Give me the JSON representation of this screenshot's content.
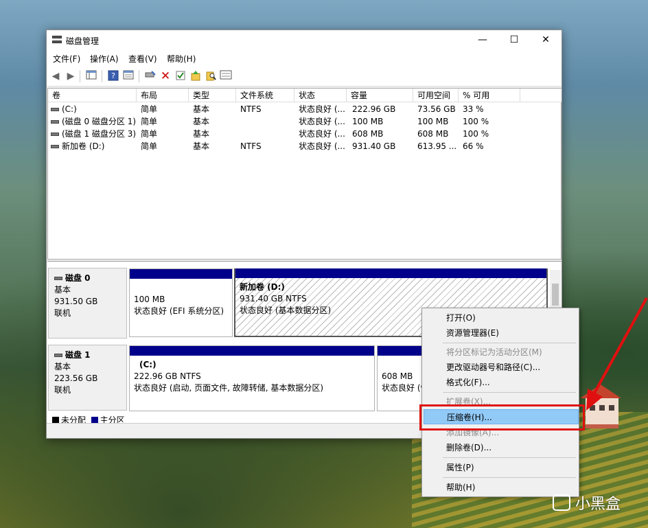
{
  "window": {
    "title": "磁盘管理",
    "controls": {
      "minimize": "—",
      "maximize": "☐",
      "close": "✕"
    }
  },
  "menu": [
    "文件(F)",
    "操作(A)",
    "查看(V)",
    "帮助(H)"
  ],
  "toolbar_icons": [
    "back-icon",
    "forward-icon",
    "console-tree-icon",
    "help-icon",
    "properties-view-icon",
    "rescan-icon",
    "delete-icon",
    "check-icon",
    "up-folder-icon",
    "search-icon",
    "list-view-icon"
  ],
  "volume_list": {
    "columns": [
      "卷",
      "布局",
      "类型",
      "文件系统",
      "状态",
      "容量",
      "可用空间",
      "% 可用"
    ],
    "rows": [
      [
        "(C:)",
        "简单",
        "基本",
        "NTFS",
        "状态良好 (...",
        "222.96 GB",
        "73.56 GB",
        "33 %"
      ],
      [
        "(磁盘 0 磁盘分区 1)",
        "简单",
        "基本",
        "",
        "状态良好 (...",
        "100 MB",
        "100 MB",
        "100 %"
      ],
      [
        "(磁盘 1 磁盘分区 3)",
        "简单",
        "基本",
        "",
        "状态良好 (...",
        "608 MB",
        "608 MB",
        "100 %"
      ],
      [
        "新加卷 (D:)",
        "简单",
        "基本",
        "NTFS",
        "状态良好 (...",
        "931.40 GB",
        "613.95 ...",
        "66 %"
      ]
    ]
  },
  "disks": [
    {
      "name": "磁盘 0",
      "type": "基本",
      "size": "931.50 GB",
      "state": "联机",
      "partitions": [
        {
          "label": "",
          "size": "100 MB",
          "status": "状态良好 (EFI 系统分区)"
        },
        {
          "label": "新加卷  (D:)",
          "size": "931.40 GB NTFS",
          "status": "状态良好 (基本数据分区)"
        }
      ]
    },
    {
      "name": "磁盘 1",
      "type": "基本",
      "size": "223.56 GB",
      "state": "联机",
      "partitions": [
        {
          "label": "(C:)",
          "size": "222.96 GB NTFS",
          "status": "状态良好 (启动, 页面文件, 故障转储, 基本数据分区)"
        },
        {
          "label": "",
          "size": "608 MB",
          "status": "状态良好 (恢"
        }
      ]
    }
  ],
  "legend": [
    {
      "label": "未分配",
      "color": "#000000"
    },
    {
      "label": "主分区",
      "color": "#00008b"
    }
  ],
  "context_menu": [
    {
      "label": "打开(O)",
      "enabled": true
    },
    {
      "label": "资源管理器(E)",
      "enabled": true
    },
    {
      "label": "将分区标记为活动分区(M)",
      "enabled": false
    },
    {
      "label": "更改驱动器号和路径(C)...",
      "enabled": true
    },
    {
      "label": "格式化(F)...",
      "enabled": true
    },
    {
      "label": "扩展卷(X)...",
      "enabled": false
    },
    {
      "label": "压缩卷(H)...",
      "enabled": true,
      "highlighted": true
    },
    {
      "label": "添加镜像(A)...",
      "enabled": false
    },
    {
      "label": "删除卷(D)...",
      "enabled": true
    },
    {
      "label": "属性(P)",
      "enabled": true
    },
    {
      "label": "帮助(H)",
      "enabled": true
    }
  ],
  "watermark": "小黑盒",
  "colors": {
    "primary_partition": "#00008b",
    "highlight": "#91c9f7",
    "annotation": "#e01010"
  }
}
